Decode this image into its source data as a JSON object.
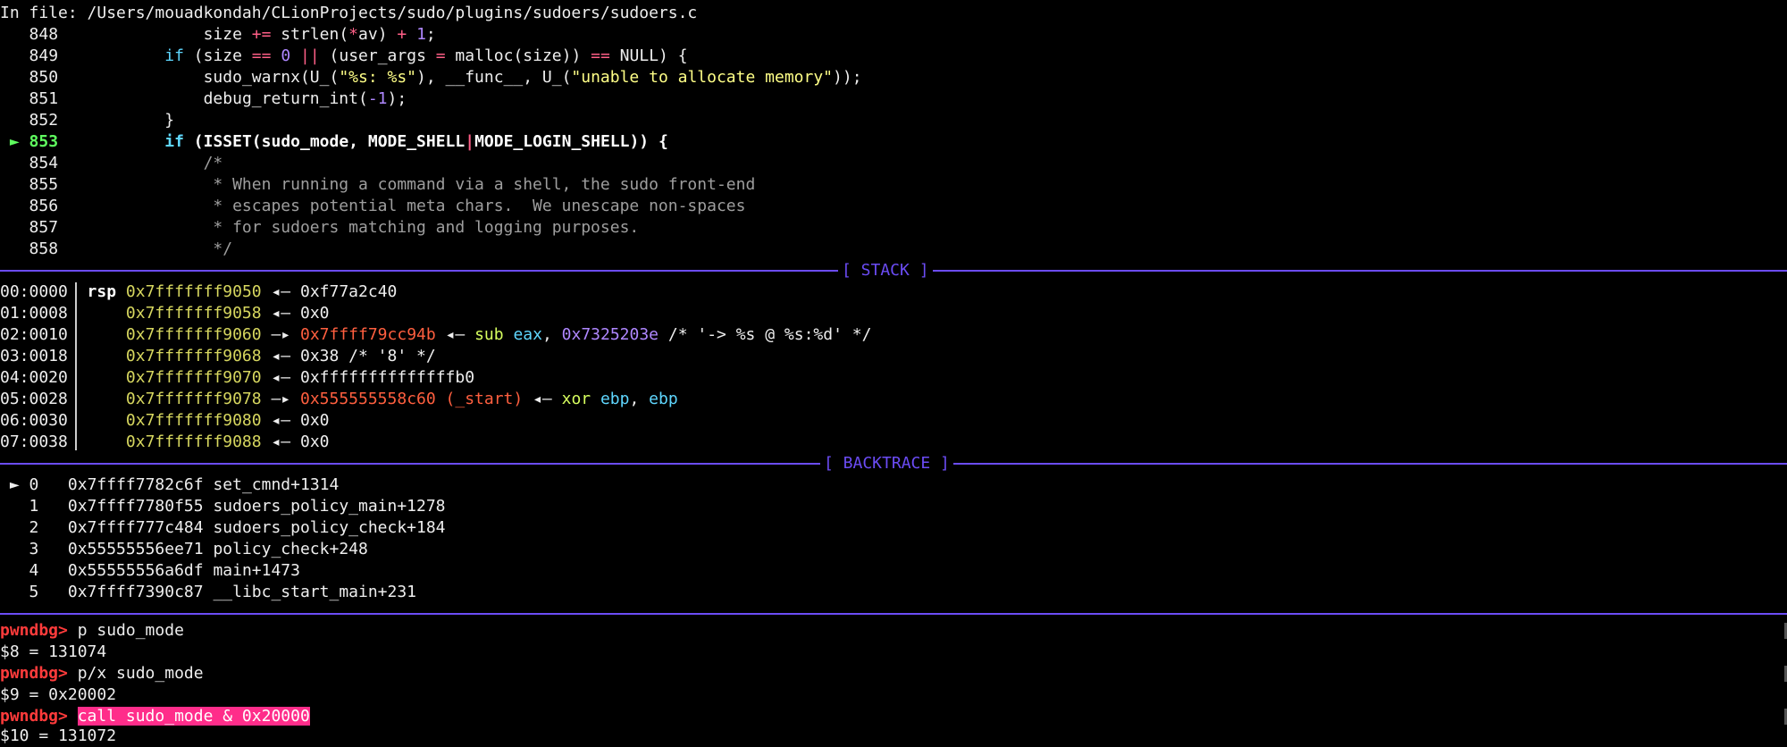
{
  "header": {
    "file_line": "In file: /Users/mouadkondah/CLionProjects/sudo/plugins/sudoers/sudoers.c"
  },
  "source": {
    "current_marker": "►",
    "lines": [
      {
        "num": "848",
        "code": "size += strlen(*av) + 1;"
      },
      {
        "num": "849",
        "code": "if (size == 0 || (user_args = malloc(size)) == NULL) {"
      },
      {
        "num": "850",
        "code": "sudo_warnx(U_(\"%s: %s\"), __func__, U_(\"unable to allocate memory\"));"
      },
      {
        "num": "851",
        "code": "debug_return_int(-1);"
      },
      {
        "num": "852",
        "code": "}"
      },
      {
        "num": "853",
        "code": "if (ISSET(sudo_mode, MODE_SHELL|MODE_LOGIN_SHELL)) {"
      },
      {
        "num": "854",
        "code": "/*"
      },
      {
        "num": "855",
        "code": "* When running a command via a shell, the sudo front-end"
      },
      {
        "num": "856",
        "code": "* escapes potential meta chars.  We unescape non-spaces"
      },
      {
        "num": "857",
        "code": "* for sudoers matching and logging purposes."
      },
      {
        "num": "858",
        "code": "*/"
      }
    ]
  },
  "stack": {
    "title": "[ STACK ]",
    "rows": [
      {
        "idx": "00:0000",
        "reg": "rsp",
        "addr": "0x7fffffff9050",
        "arrow": "◂—",
        "val": "0xf77a2c40"
      },
      {
        "idx": "01:0008",
        "reg": "",
        "addr": "0x7fffffff9058",
        "arrow": "◂—",
        "val": "0x0"
      },
      {
        "idx": "02:0010",
        "reg": "",
        "addr": "0x7fffffff9060",
        "arrow": "—▸",
        "ptr": "0x7ffff79cc94b",
        "arrow2": "◂—",
        "ins": "sub",
        "r1": "eax",
        "imm": "0x7325203e",
        "cmt": "/* '-> %s @ %s:%d' */"
      },
      {
        "idx": "03:0018",
        "reg": "",
        "addr": "0x7fffffff9068",
        "arrow": "◂—",
        "val": "0x38 /* '8' */"
      },
      {
        "idx": "04:0020",
        "reg": "",
        "addr": "0x7fffffff9070",
        "arrow": "◂—",
        "val": "0xffffffffffffffb0"
      },
      {
        "idx": "05:0028",
        "reg": "",
        "addr": "0x7fffffff9078",
        "arrow": "—▸",
        "ptr": "0x555555558c60 (_start)",
        "arrow2": "◂—",
        "ins": "xor",
        "r1": "ebp",
        "r2": "ebp"
      },
      {
        "idx": "06:0030",
        "reg": "",
        "addr": "0x7fffffff9080",
        "arrow": "◂—",
        "val": "0x0"
      },
      {
        "idx": "07:0038",
        "reg": "",
        "addr": "0x7fffffff9088",
        "arrow": "◂—",
        "val": "0x0"
      }
    ]
  },
  "backtrace": {
    "title": "[ BACKTRACE ]",
    "marker": "►",
    "frames": [
      {
        "n": "0",
        "addr": "0x7ffff7782c6f",
        "sym": "set_cmnd+1314"
      },
      {
        "n": "1",
        "addr": "0x7ffff7780f55",
        "sym": "sudoers_policy_main+1278"
      },
      {
        "n": "2",
        "addr": "0x7ffff777c484",
        "sym": "sudoers_policy_check+184"
      },
      {
        "n": "3",
        "addr": "0x55555556ee71",
        "sym": "policy_check+248"
      },
      {
        "n": "4",
        "addr": "0x55555556a6df",
        "sym": "main+1473"
      },
      {
        "n": "5",
        "addr": "0x7ffff7390c87",
        "sym": "__libc_start_main+231"
      }
    ]
  },
  "console": {
    "prompt": "pwndbg>",
    "entries": [
      {
        "cmd": "p sudo_mode",
        "out": "$8 = 131074"
      },
      {
        "cmd": "p/x sudo_mode",
        "out": "$9 = 0x20002"
      },
      {
        "cmd": "call sudo_mode & 0x20000",
        "out": "$10 = 131072"
      }
    ]
  },
  "colors": {
    "separator": "#6b4cf5",
    "prompt": "#ff3b3b",
    "highlight": "#ff2d8a",
    "current_line": "#5fff5f"
  }
}
